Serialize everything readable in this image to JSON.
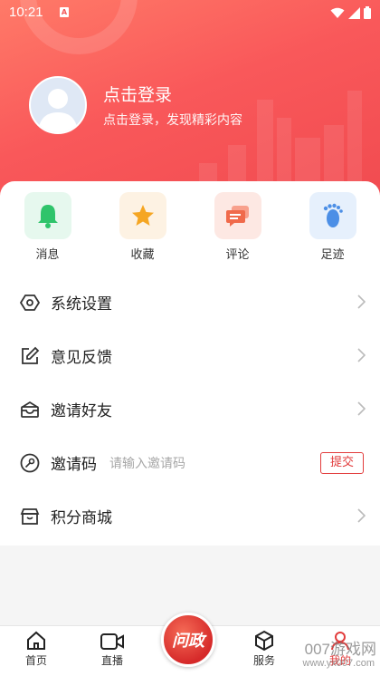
{
  "status_bar": {
    "time": "10:21",
    "sim_badge": "A"
  },
  "profile": {
    "title": "点击登录",
    "subtitle": "点击登录，发现精彩内容"
  },
  "quick_actions": [
    {
      "label": "消息",
      "icon": "bell-icon",
      "bg": "#e6f8ee",
      "color": "#2fc46b"
    },
    {
      "label": "收藏",
      "icon": "star-icon",
      "bg": "#fdf2e3",
      "color": "#f5a623"
    },
    {
      "label": "评论",
      "icon": "comment-icon",
      "bg": "#fde8e3",
      "color": "#f06a4b"
    },
    {
      "label": "足迹",
      "icon": "footprint-icon",
      "bg": "#e6f0fc",
      "color": "#4c8fe6"
    }
  ],
  "menu": {
    "settings": "系统设置",
    "feedback": "意见反馈",
    "invite_friends": "邀请好友",
    "invite_code": {
      "label": "邀请码",
      "placeholder": "请输入邀请码",
      "submit": "提交"
    },
    "points_mall": "积分商城"
  },
  "tabbar": {
    "home": "首页",
    "live": "直播",
    "center": "问政",
    "services": "服务",
    "mine": "我的"
  },
  "watermark": {
    "text": "007游戏网",
    "url": "www.yx007.com"
  },
  "colors": {
    "brand_red": "#f04a4f",
    "accent": "#e23c3c"
  }
}
